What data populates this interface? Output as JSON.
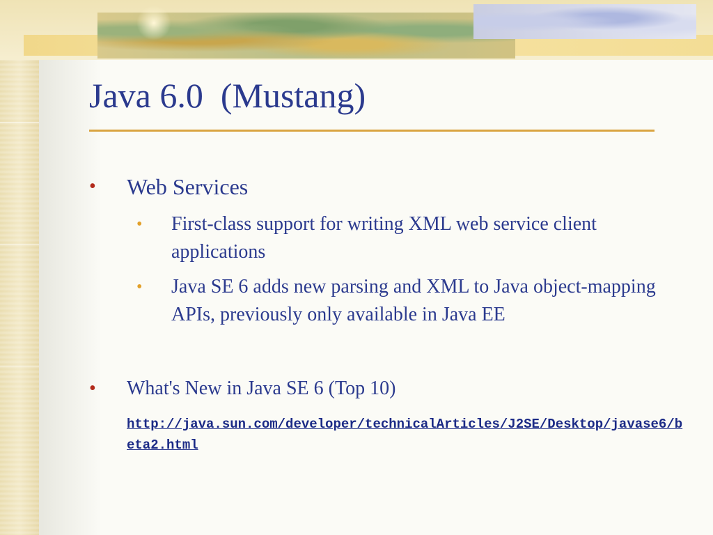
{
  "slide": {
    "title": "Java 6.0  (Mustang)",
    "bullets": [
      {
        "label": "Web Services",
        "sub": [
          {
            "text": "First-class support for writing XML web service client applications"
          },
          {
            "text": "Java SE 6 adds new parsing and XML to Java object-mapping APIs, previously only available in Java EE"
          }
        ]
      },
      {
        "label": "What's New in Java SE 6 (Top 10)",
        "link": "http://java.sun.com/developer/technicalArticles/J2SE/Desktop/javase6/beta2.html"
      }
    ]
  },
  "icons": {
    "level1_bullet": "bullet-dot",
    "level2_bullet": "bullet-dot"
  },
  "colors": {
    "text": "#2b3a8e",
    "title_rule": "#d9a441",
    "level1_bullet": "#b22a1a",
    "level2_bullet": "#e2a02a",
    "link": "#1b2a86"
  }
}
